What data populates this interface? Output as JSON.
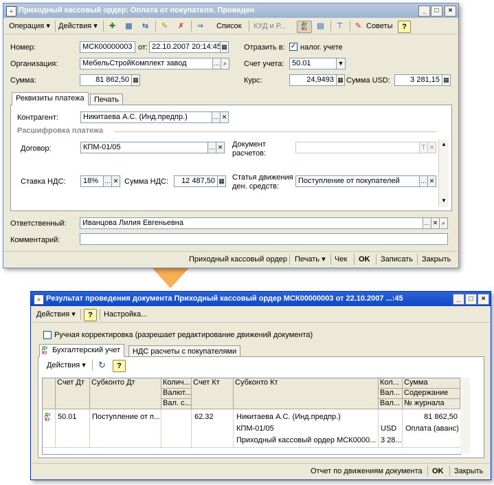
{
  "win1": {
    "title": "Приходный кассовый ордер: Оплата от покупателя. Проведен",
    "toolbar": {
      "operation": "Операция ▾",
      "actions": "Действия ▾",
      "list": "Список",
      "kud": "КУД и Р...",
      "dtkt_top": "Дт",
      "dtkt_bottom": "Кт",
      "advice": "Советы",
      "help": "?"
    },
    "fields": {
      "number_label": "Номер:",
      "number_value": "МСК00000003",
      "from_label": "от:",
      "date_value": "22.10.2007 20:14:45",
      "reflect_label": "Отразить в:",
      "tax_label": "налог. учете",
      "org_label": "Организация:",
      "org_value": "МебельСтройКомплект завод",
      "account_label": "Счет учета:",
      "account_value": "50.01",
      "sum_label": "Сумма:",
      "sum_value": "81 862,50",
      "rate_label": "Курс:",
      "rate_value": "24,9493",
      "sum_usd_label": "Сумма USD:",
      "sum_usd_value": "3 281,15"
    },
    "tabs": [
      "Реквизиты платежа",
      "Печать"
    ],
    "payment": {
      "counterparty_label": "Контрагент:",
      "counterparty_value": "Никитаева А.С. (Инд.предпр.)",
      "section_title": "Расшифровка платежа",
      "contract_label": "Договор:",
      "contract_value": "КПМ-01/05",
      "doc_label_1": "Документ",
      "doc_label_2": "расчетов:",
      "doc_value": "",
      "vat_rate_label": "Ставка НДС:",
      "vat_rate_value": "18%",
      "vat_sum_label": "Сумма НДС:",
      "vat_sum_value": "12 487,50",
      "cashflow_label_1": "Статья движения",
      "cashflow_label_2": "ден. средств:",
      "cashflow_value": "Поступление от покупателей"
    },
    "responsible_label": "Ответственный:",
    "responsible_value": "Иванцова Лилия Евгеньевна",
    "comment_label": "Комментарий:",
    "comment_value": "",
    "bottom": {
      "pko": "Приходный кассовый ордер",
      "print": "Печать ▾",
      "check": "Чек",
      "ok": "OK",
      "save": "Записать",
      "close": "Закрыть"
    }
  },
  "win2": {
    "title": "Результат проведения документа Приходный кассовый ордер МСК00000003 от 22.10.2007 ...:45",
    "toolbar": {
      "actions": "Действия ▾",
      "help": "?",
      "settings": "Настройка..."
    },
    "manual_label": "Ручная корректировка (разрешает редактирование движений документа)",
    "tabs": [
      "Бухгалтерский учет",
      "НДС расчеты с покупателями"
    ],
    "grid_toolbar": {
      "actions": "Действия ▾",
      "help": "?"
    },
    "columns": {
      "c1": "Счет Дт",
      "c2": "Субконто Дт",
      "c3a": "Колич...",
      "c3b": "Валют...",
      "c3c": "Вал. с...",
      "c4": "Счет Кт",
      "c5": "Субконто Кт",
      "c6a": "Кол...",
      "c6b": "Вал...",
      "c6c": "Вал...",
      "c7a": "Сумма",
      "c7b": "Содержание",
      "c7c": "№ журнала"
    },
    "row": {
      "acc_dt": "50.01",
      "sub_dt": "Поступление от п...",
      "acc_kt": "62.32",
      "sub_kt_1": "Никитаева А.С. (Инд.предпр.)",
      "sub_kt_2": "КПМ-01/05",
      "sub_kt_3": "Приходный кассовый ордер МСК0000...",
      "cur": "USD",
      "cur_sum": "3 28...",
      "sum": "81 862,50",
      "content": "Оплата (аванс)"
    },
    "bottom": {
      "report": "Отчет по движениям документа",
      "ok": "OK",
      "close": "Закрыть"
    }
  },
  "colors": {
    "arrow": "#f7a23a",
    "title_active": "#0f48c6",
    "title_inactive": "#a9bcd8",
    "section": "#8a8a8a"
  }
}
